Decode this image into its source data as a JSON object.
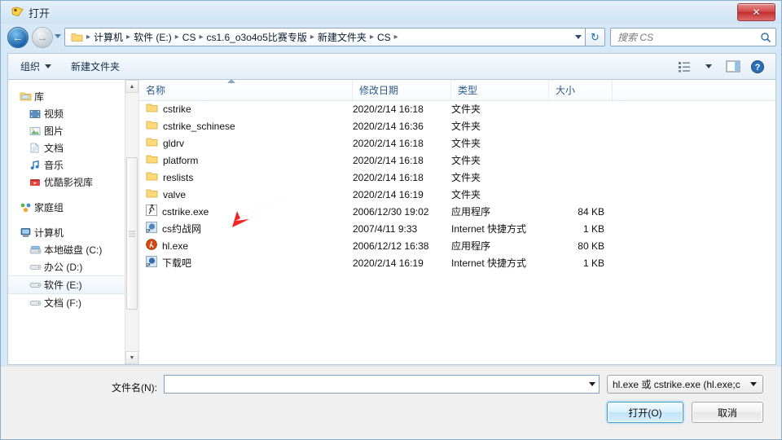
{
  "window": {
    "title": "打开",
    "title_icon": "open-folder-icon",
    "close_label": "✕"
  },
  "nav": {
    "back_icon": "back-arrow-icon",
    "forward_icon": "forward-arrow-icon",
    "history_icon": "history-dropdown-icon",
    "refresh_icon": "refresh-icon",
    "breadcrumbs": [
      "计算机",
      "软件 (E:)",
      "CS",
      "cs1.6_o3o4o5比赛专版",
      "新建文件夹",
      "CS"
    ],
    "separator": "▸"
  },
  "search": {
    "placeholder": "搜索 CS",
    "value": "",
    "icon": "search-icon"
  },
  "toolbar": {
    "organize_label": "组织",
    "new_folder_label": "新建文件夹",
    "view_icon": "view-options-icon",
    "preview_icon": "preview-pane-icon",
    "help_icon": "help-icon"
  },
  "sidebar": {
    "groups": [
      {
        "header": {
          "label": "库",
          "icon": "library-icon"
        },
        "items": [
          {
            "label": "视频",
            "icon": "videos-icon",
            "selected": false
          },
          {
            "label": "图片",
            "icon": "pictures-icon",
            "selected": false
          },
          {
            "label": "文档",
            "icon": "documents-icon",
            "selected": false
          },
          {
            "label": "音乐",
            "icon": "music-icon",
            "selected": false
          },
          {
            "label": "优酷影视库",
            "icon": "youku-library-icon",
            "selected": false
          }
        ]
      },
      {
        "header": {
          "label": "家庭组",
          "icon": "homegroup-icon"
        },
        "items": []
      },
      {
        "header": {
          "label": "计算机",
          "icon": "computer-icon"
        },
        "items": [
          {
            "label": "本地磁盘 (C:)",
            "icon": "system-drive-icon",
            "selected": false
          },
          {
            "label": "办公 (D:)",
            "icon": "drive-icon",
            "selected": false
          },
          {
            "label": "软件 (E:)",
            "icon": "drive-icon",
            "selected": true
          },
          {
            "label": "文档 (F:)",
            "icon": "drive-icon",
            "selected": false
          }
        ]
      }
    ]
  },
  "filelist": {
    "columns": [
      "名称",
      "修改日期",
      "类型",
      "大小"
    ],
    "sorted_by": "名称",
    "rows": [
      {
        "name": "cstrike",
        "icon": "folder-icon",
        "date": "2020/2/14 16:18",
        "type": "文件夹",
        "size": ""
      },
      {
        "name": "cstrike_schinese",
        "icon": "folder-icon",
        "date": "2020/2/14 16:36",
        "type": "文件夹",
        "size": ""
      },
      {
        "name": "gldrv",
        "icon": "folder-icon",
        "date": "2020/2/14 16:18",
        "type": "文件夹",
        "size": ""
      },
      {
        "name": "platform",
        "icon": "folder-icon",
        "date": "2020/2/14 16:18",
        "type": "文件夹",
        "size": ""
      },
      {
        "name": "reslists",
        "icon": "folder-icon",
        "date": "2020/2/14 16:18",
        "type": "文件夹",
        "size": ""
      },
      {
        "name": "valve",
        "icon": "folder-icon",
        "date": "2020/2/14 16:19",
        "type": "文件夹",
        "size": ""
      },
      {
        "name": "cstrike.exe",
        "icon": "cstrike-exe-icon",
        "date": "2006/12/30 19:02",
        "type": "应用程序",
        "size": "84 KB"
      },
      {
        "name": "cs约战网",
        "icon": "internet-shortcut-icon",
        "date": "2007/4/11 9:33",
        "type": "Internet 快捷方式",
        "size": "1 KB"
      },
      {
        "name": "hl.exe",
        "icon": "halflife-exe-icon",
        "date": "2006/12/12 16:38",
        "type": "应用程序",
        "size": "80 KB"
      },
      {
        "name": "下载吧",
        "icon": "internet-shortcut-icon",
        "date": "2020/2/14 16:19",
        "type": "Internet 快捷方式",
        "size": "1 KB"
      }
    ]
  },
  "footer": {
    "filename_label": "文件名(N):",
    "filename_value": "",
    "filetype_value": "hl.exe 或 cstrike.exe (hl.exe;c",
    "open_label": "打开(O)",
    "cancel_label": "取消"
  },
  "annotation": {
    "arrow_color": "#f3231f",
    "points_to": "cstrike.exe"
  }
}
